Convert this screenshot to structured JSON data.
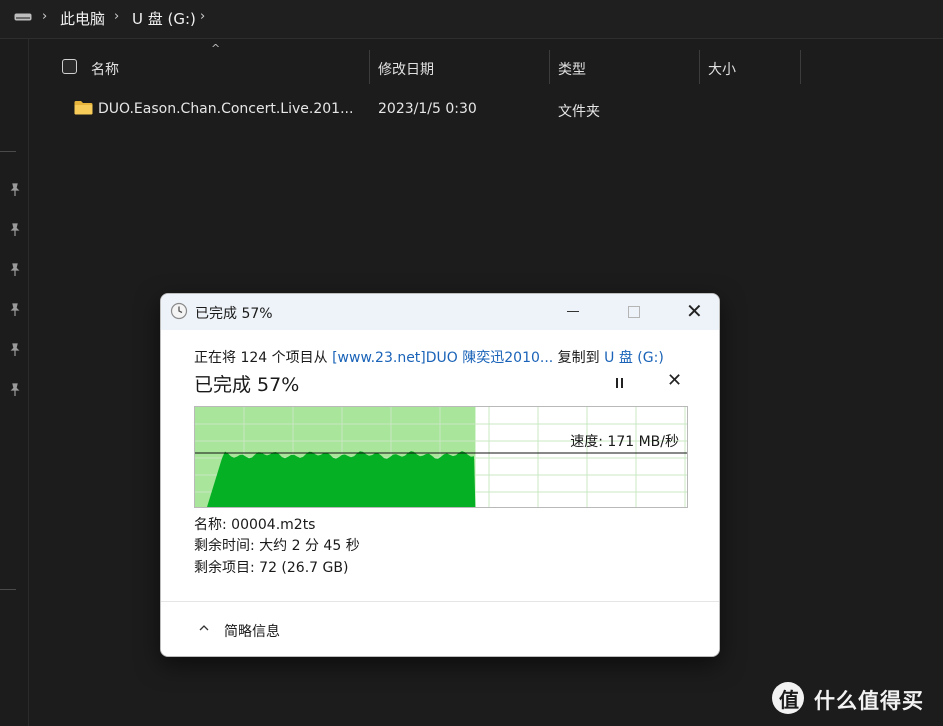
{
  "explorer": {
    "breadcrumb": [
      "此电脑",
      "U 盘 (G:)"
    ],
    "columns": {
      "name": "名称",
      "modified": "修改日期",
      "type": "类型",
      "size": "大小"
    },
    "rows": [
      {
        "name": "DUO.Eason.Chan.Concert.Live.201...",
        "modified": "2023/1/5 0:30",
        "type": "文件夹",
        "size": ""
      }
    ],
    "pinned_count": 6
  },
  "dialog": {
    "title": "已完成 57%",
    "copy_line": {
      "prefix": "正在将 124 个项目从 ",
      "source": "[www.23.net]DUO 陳奕迅2010...",
      "middle": " 复制到 ",
      "destination": "U 盘 (G:)"
    },
    "status": "已完成 57%",
    "progress_fraction": 0.57,
    "speed_label": "速度: 171 MB/秒",
    "speed_value_mb_s": 171,
    "name_line": "名称: 00004.m2ts",
    "time_left_line": "剩余时间: 大约 2 分 45 秒",
    "items_left_line": "剩余项目: 72 (26.7 GB)",
    "footer_toggle": "简略信息",
    "colors": {
      "graph_done_bg": "#a9e59b",
      "graph_fill": "#06b024",
      "graph_grid": "#c9e8c3",
      "link": "#1a63b8"
    }
  },
  "watermark": {
    "logo_glyph": "值",
    "text": "什么值得买"
  }
}
